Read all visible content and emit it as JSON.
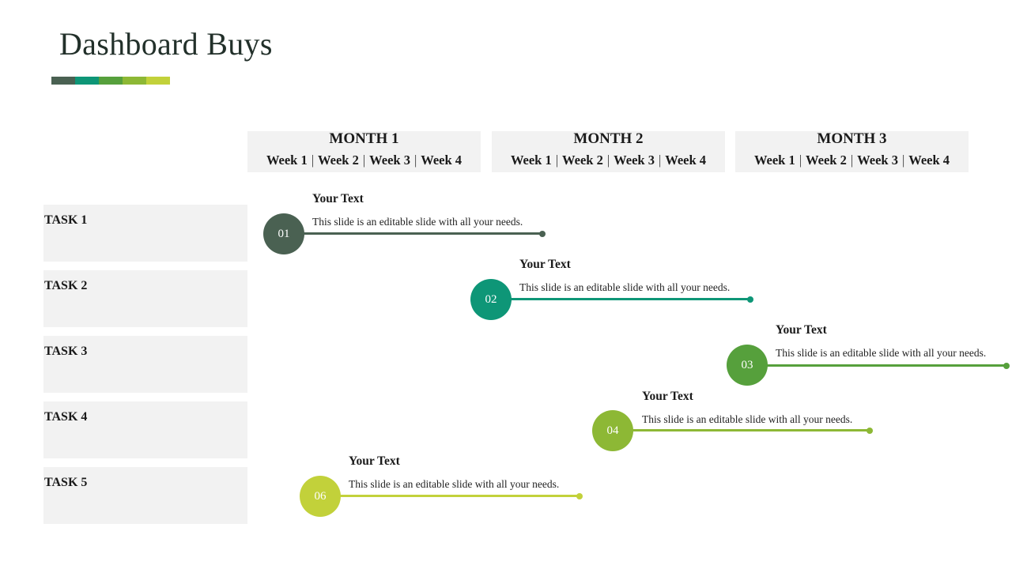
{
  "title": "Dashboard Buys",
  "palette": [
    "#4a6152",
    "#0e9677",
    "#56a03c",
    "#8db835",
    "#c2d13a"
  ],
  "months": [
    {
      "label": "MONTH 1",
      "weeks": [
        "Week 1",
        "Week 2",
        "Week 3",
        "Week 4"
      ]
    },
    {
      "label": "MONTH 2",
      "weeks": [
        "Week 1",
        "Week 2",
        "Week 3",
        "Week 4"
      ]
    },
    {
      "label": "MONTH 3",
      "weeks": [
        "Week 1",
        "Week 2",
        "Week 3",
        "Week 4"
      ]
    }
  ],
  "tasks": [
    "TASK 1",
    "TASK 2",
    "TASK 3",
    "TASK 4",
    "TASK 5"
  ],
  "items": [
    {
      "number": "01",
      "heading": "Your Text",
      "description": "This slide is an editable slide with all your needs.",
      "color": "#4a6152"
    },
    {
      "number": "02",
      "heading": "Your Text",
      "description": "This slide is an editable slide with all your needs.",
      "color": "#0e9677"
    },
    {
      "number": "03",
      "heading": "Your Text",
      "description": "This slide is an editable slide with all your needs.",
      "color": "#56a03c"
    },
    {
      "number": "04",
      "heading": "Your Text",
      "description": "This slide is an editable slide with all your needs.",
      "color": "#8db835"
    },
    {
      "number": "06",
      "heading": "Your Text",
      "description": "This slide is an editable slide with all your needs.",
      "color": "#c2d13a"
    }
  ]
}
